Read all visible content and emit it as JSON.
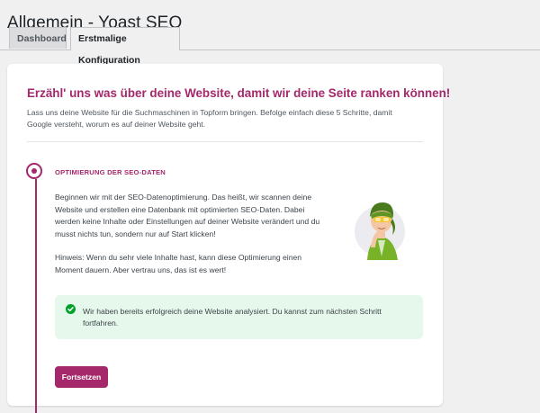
{
  "page": {
    "title": "Allgemein - Yoast SEO"
  },
  "tabs": [
    {
      "label": "Dashboard"
    },
    {
      "label": "Erstmalige Konfiguration"
    }
  ],
  "card": {
    "headline": "Erzähl' uns was über deine Website, damit wir deine Seite ranken können!",
    "intro": "Lass uns deine Website für die Suchmaschinen in Topform bringen. Befolge einfach diese 5 Schritte, damit Google versteht, worum es auf deiner Website geht.",
    "step": {
      "title": "OPTIMIERUNG DER SEO-DATEN",
      "body": "Beginnen wir mit der SEO-Datenoptimierung. Das heißt, wir scannen deine Website und erstellen eine Datenbank mit optimierten SEO-Daten. Dabei werden keine Inhalte oder Einstellungen auf deiner Website verändert und du musst nichts tun, sondern nur auf Start klicken!",
      "hint": "Hinweis: Wenn du sehr viele Inhalte hast, kann diese Optimierung einen Moment dauern. Aber vertrau uns, das ist es wert!",
      "success": "Wir haben bereits erfolgreich deine Website analysiert. Du kannst zum nächsten Schritt fortfahren.",
      "button_label": "Fortsetzen"
    }
  },
  "colors": {
    "accent": "#a4286a",
    "success_bg": "#e6f8eb",
    "success_icon": "#00a32a"
  },
  "icons": {
    "step_marker": "step-active-icon",
    "success": "check-circle-icon",
    "illustration": "yoast-character-illustration"
  }
}
